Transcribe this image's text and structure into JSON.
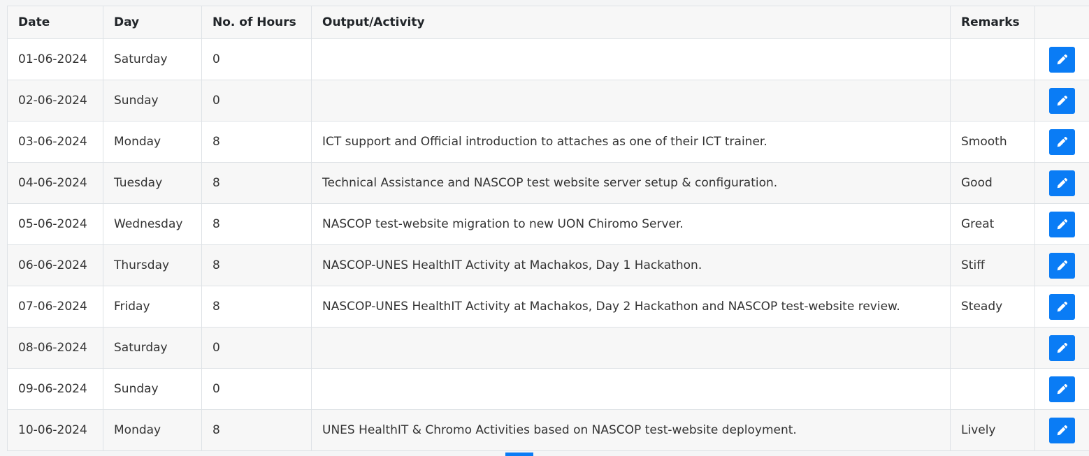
{
  "table": {
    "headers": {
      "date": "Date",
      "day": "Day",
      "hours": "No. of Hours",
      "activity": "Output/Activity",
      "remarks": "Remarks",
      "actions": ""
    },
    "rows": [
      {
        "date": "01-06-2024",
        "day": "Saturday",
        "hours": "0",
        "activity": "",
        "remarks": ""
      },
      {
        "date": "02-06-2024",
        "day": "Sunday",
        "hours": "0",
        "activity": "",
        "remarks": ""
      },
      {
        "date": "03-06-2024",
        "day": "Monday",
        "hours": "8",
        "activity": "ICT support and Official introduction to attaches as one of their ICT trainer.",
        "remarks": "Smooth"
      },
      {
        "date": "04-06-2024",
        "day": "Tuesday",
        "hours": "8",
        "activity": "Technical Assistance and NASCOP test website server setup & configuration.",
        "remarks": "Good"
      },
      {
        "date": "05-06-2024",
        "day": "Wednesday",
        "hours": "8",
        "activity": "NASCOP test-website migration to new UON Chiromo Server.",
        "remarks": "Great"
      },
      {
        "date": "06-06-2024",
        "day": "Thursday",
        "hours": "8",
        "activity": "NASCOP-UNES HealthIT Activity at Machakos, Day 1 Hackathon.",
        "remarks": "Stiff"
      },
      {
        "date": "07-06-2024",
        "day": "Friday",
        "hours": "8",
        "activity": "NASCOP-UNES HealthIT Activity at Machakos, Day 2 Hackathon and NASCOP test-website review.",
        "remarks": "Steady"
      },
      {
        "date": "08-06-2024",
        "day": "Saturday",
        "hours": "0",
        "activity": "",
        "remarks": ""
      },
      {
        "date": "09-06-2024",
        "day": "Sunday",
        "hours": "0",
        "activity": "",
        "remarks": ""
      },
      {
        "date": "10-06-2024",
        "day": "Monday",
        "hours": "8",
        "activity": "UNES HealthIT & Chromo Activities based on NASCOP test-website deployment.",
        "remarks": "Lively"
      }
    ],
    "row_action_icon": "pencil-icon"
  },
  "colors": {
    "accent": "#0a7cf5",
    "border": "#dee2e6",
    "stripe": "#f7f7f7"
  }
}
